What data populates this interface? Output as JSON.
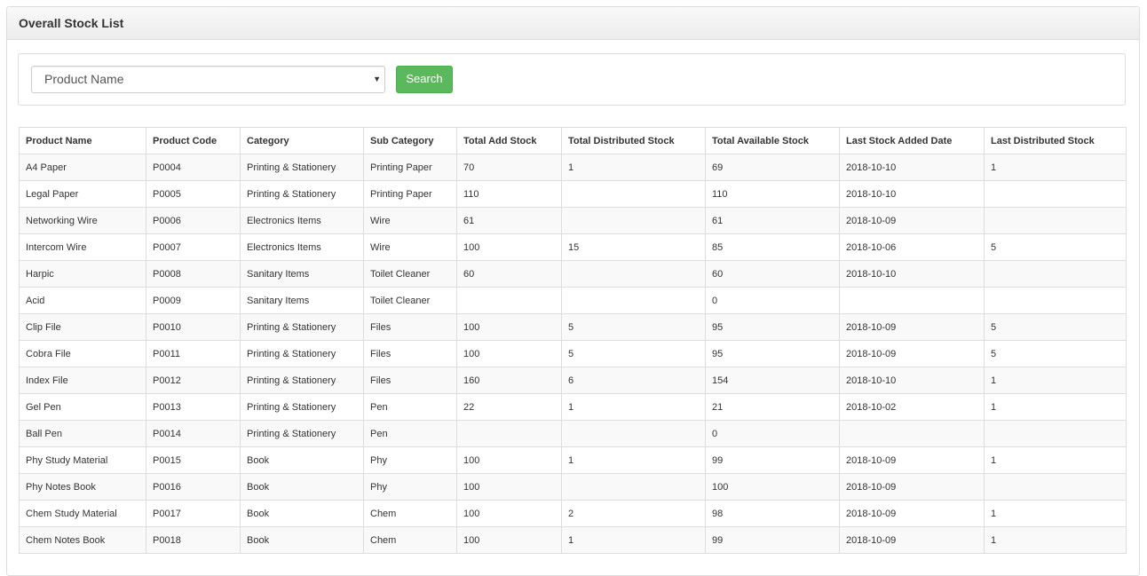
{
  "panel": {
    "title": "Overall Stock List"
  },
  "filter": {
    "select_value": "Product Name",
    "search_label": "Search"
  },
  "table": {
    "columns": [
      "Product Name",
      "Product Code",
      "Category",
      "Sub Category",
      "Total Add Stock",
      "Total Distributed Stock",
      "Total Available Stock",
      "Last Stock Added Date",
      "Last Distributed Stock"
    ],
    "rows": [
      [
        "A4 Paper",
        "P0004",
        "Printing & Stationery",
        "Printing Paper",
        "70",
        "1",
        "69",
        "2018-10-10",
        "1"
      ],
      [
        "Legal Paper",
        "P0005",
        "Printing & Stationery",
        "Printing Paper",
        "110",
        "",
        "110",
        "2018-10-10",
        ""
      ],
      [
        "Networking Wire",
        "P0006",
        "Electronics Items",
        "Wire",
        "61",
        "",
        "61",
        "2018-10-09",
        ""
      ],
      [
        "Intercom Wire",
        "P0007",
        "Electronics Items",
        "Wire",
        "100",
        "15",
        "85",
        "2018-10-06",
        "5"
      ],
      [
        "Harpic",
        "P0008",
        "Sanitary Items",
        "Toilet Cleaner",
        "60",
        "",
        "60",
        "2018-10-10",
        ""
      ],
      [
        "Acid",
        "P0009",
        "Sanitary Items",
        "Toilet Cleaner",
        "",
        "",
        "0",
        "",
        ""
      ],
      [
        "Clip File",
        "P0010",
        "Printing & Stationery",
        "Files",
        "100",
        "5",
        "95",
        "2018-10-09",
        "5"
      ],
      [
        "Cobra File",
        "P0011",
        "Printing & Stationery",
        "Files",
        "100",
        "5",
        "95",
        "2018-10-09",
        "5"
      ],
      [
        "Index File",
        "P0012",
        "Printing & Stationery",
        "Files",
        "160",
        "6",
        "154",
        "2018-10-10",
        "1"
      ],
      [
        "Gel Pen",
        "P0013",
        "Printing & Stationery",
        "Pen",
        "22",
        "1",
        "21",
        "2018-10-02",
        "1"
      ],
      [
        "Ball Pen",
        "P0014",
        "Printing & Stationery",
        "Pen",
        "",
        "",
        "0",
        "",
        ""
      ],
      [
        "Phy Study Material",
        "P0015",
        "Book",
        "Phy",
        "100",
        "1",
        "99",
        "2018-10-09",
        "1"
      ],
      [
        "Phy Notes Book",
        "P0016",
        "Book",
        "Phy",
        "100",
        "",
        "100",
        "2018-10-09",
        ""
      ],
      [
        "Chem Study Material",
        "P0017",
        "Book",
        "Chem",
        "100",
        "2",
        "98",
        "2018-10-09",
        "1"
      ],
      [
        "Chem Notes Book",
        "P0018",
        "Book",
        "Chem",
        "100",
        "1",
        "99",
        "2018-10-09",
        "1"
      ]
    ]
  },
  "icons": {
    "select_caret": "▼"
  }
}
